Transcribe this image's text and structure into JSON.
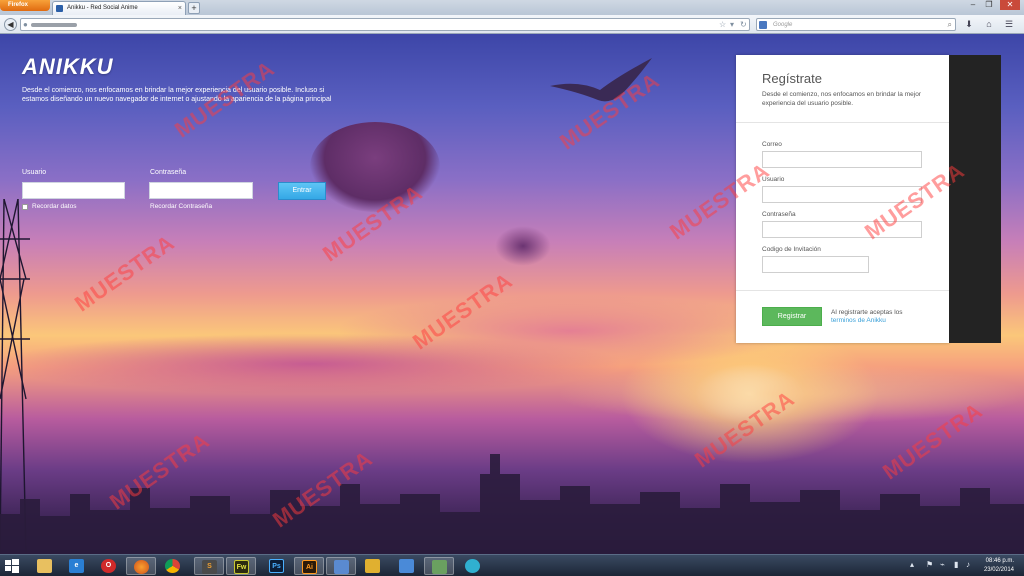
{
  "browser": {
    "app_button": "Firefox",
    "tab_title": "Anikku - Red Social Anime",
    "new_tab": "+",
    "search_placeholder": "Google",
    "icons": {
      "back": "back-arrow-icon",
      "bookmark": "star-icon",
      "reload": "reload-icon",
      "download": "download-icon",
      "home": "home-icon",
      "menu": "menu-icon"
    }
  },
  "site": {
    "logo": "ANIKKU",
    "tagline": "Desde el comienzo, nos enfocamos en brindar la mejor experiencia del usuario posible. Incluso si estamos diseñando un nuevo navegador de internet o ajustando la apariencia de la página principal"
  },
  "login": {
    "username_label": "Usuario",
    "password_label": "Contraseña",
    "remember_label": "Recordar datos",
    "forgot_label": "Recordar Contraseña",
    "submit_label": "Entrar"
  },
  "register": {
    "title": "Regístrate",
    "subtitle": "Desde el comienzo, nos enfocamos en brindar la mejor experiencia del usuario posible.",
    "email_label": "Correo",
    "username_label": "Usuario",
    "password_label": "Contraseña",
    "invite_label": "Codigo de Invitación",
    "submit_label": "Registrar",
    "terms_prefix": "Al registrarte aceptas los",
    "terms_link": "terminos de Anikku"
  },
  "watermark": "MUESTRA",
  "taskbar": {
    "apps": [
      {
        "name": "explorer",
        "label": ""
      },
      {
        "name": "internet-explorer",
        "label": "e"
      },
      {
        "name": "opera",
        "label": "O"
      },
      {
        "name": "firefox",
        "label": ""
      },
      {
        "name": "chrome",
        "label": ""
      },
      {
        "name": "sublime",
        "label": "S"
      },
      {
        "name": "fireworks",
        "label": "Fw"
      },
      {
        "name": "photoshop",
        "label": "Ps"
      },
      {
        "name": "illustrator",
        "label": "Ai"
      },
      {
        "name": "app-1",
        "label": ""
      },
      {
        "name": "app-2",
        "label": ""
      },
      {
        "name": "app-3",
        "label": ""
      },
      {
        "name": "app-4",
        "label": ""
      },
      {
        "name": "app-5",
        "label": ""
      }
    ],
    "clock_time": "08:46 p.m.",
    "clock_date": "23/02/2014"
  },
  "colors": {
    "accent_blue": "#34a8e6",
    "accent_green": "#5cb85c",
    "link": "#3aa0d8"
  }
}
